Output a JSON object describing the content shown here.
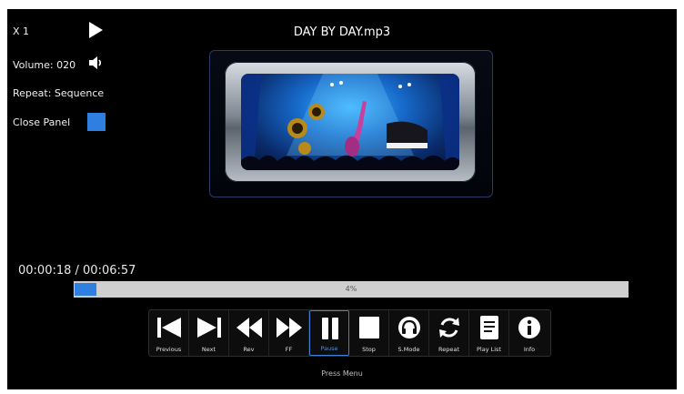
{
  "status": {
    "speed": "X 1",
    "volume": "Volume: 020",
    "repeat": "Repeat: Sequence",
    "close_panel": "Close Panel"
  },
  "track": {
    "title": "DAY BY DAY.mp3",
    "time": "00:00:18 / 00:06:57",
    "progress_label": "4%",
    "progress_fraction": 0.04
  },
  "controls": [
    {
      "label": "Previous",
      "icon": "skip-previous-icon"
    },
    {
      "label": "Next",
      "icon": "skip-next-icon"
    },
    {
      "label": "Rev",
      "icon": "rewind-icon"
    },
    {
      "label": "FF",
      "icon": "fast-forward-icon"
    },
    {
      "label": "Pause",
      "icon": "pause-icon",
      "active": true
    },
    {
      "label": "Stop",
      "icon": "stop-icon"
    },
    {
      "label": "S.Mode",
      "icon": "sound-mode-icon"
    },
    {
      "label": "Repeat",
      "icon": "repeat-icon"
    },
    {
      "label": "Play List",
      "icon": "playlist-icon"
    },
    {
      "label": "Info",
      "icon": "info-icon"
    }
  ],
  "footer": {
    "hint": "Press Menu"
  },
  "colors": {
    "background": "#000000",
    "accent": "#2f7fe0",
    "progress_track": "#cfcfcf"
  }
}
